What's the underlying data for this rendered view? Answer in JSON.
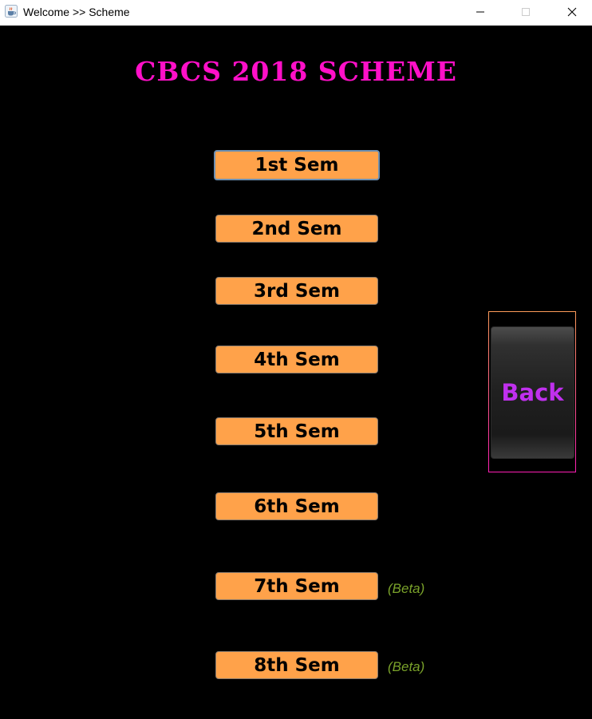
{
  "window": {
    "title": "Welcome >> Scheme",
    "app_icon": "java-cup-icon",
    "controls": {
      "minimize_icon": "minimize-icon",
      "maximize_icon": "maximize-icon",
      "close_icon": "close-icon"
    }
  },
  "heading": "CBCS 2018 SCHEME",
  "semesters": [
    {
      "label": "1st Sem",
      "focused": true
    },
    {
      "label": "2nd Sem"
    },
    {
      "label": "3rd Sem"
    },
    {
      "label": "4th Sem"
    },
    {
      "label": "5th Sem"
    },
    {
      "label": "6th Sem"
    },
    {
      "label": "7th Sem",
      "tag": "(Beta)"
    },
    {
      "label": "8th Sem",
      "tag": "(Beta)"
    }
  ],
  "back_label": "Back",
  "colors": {
    "background": "#000000",
    "heading": "#ff10c8",
    "button": "#ffa24a",
    "beta": "#7aa22a",
    "back_text": "#c030ee"
  }
}
